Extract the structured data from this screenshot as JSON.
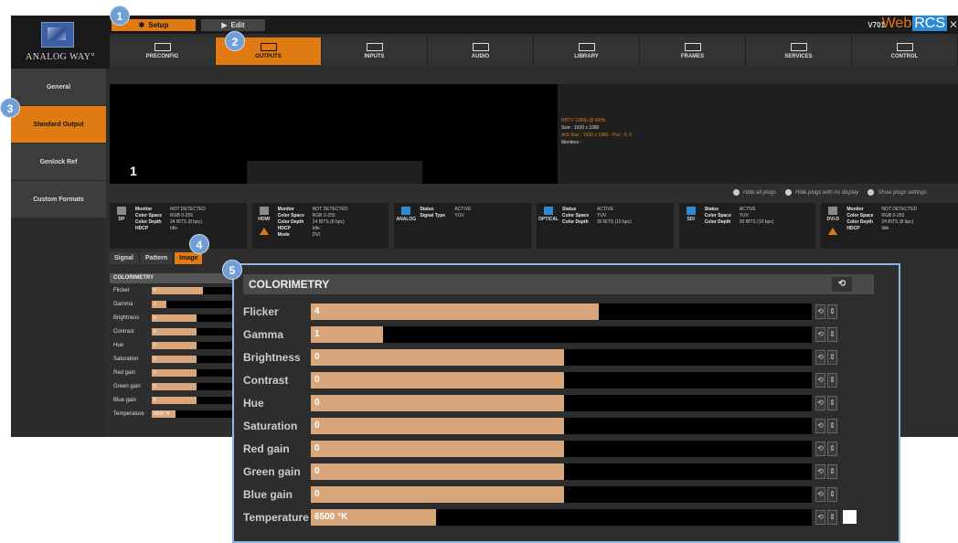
{
  "topbar": {
    "logo_text": "ANALOG WAY°",
    "mode_setup": "Setup",
    "mode_edit": "Edit",
    "version": "V701",
    "brand_web": "Web",
    "brand_rcs": "RCS",
    "close": "✕"
  },
  "nav": {
    "tabs": [
      {
        "label": "PRECONFIG"
      },
      {
        "label": "OUTPUTS"
      },
      {
        "label": "INPUTS"
      },
      {
        "label": "AUDIO"
      },
      {
        "label": "LIBRARY"
      },
      {
        "label": "FRAMES"
      },
      {
        "label": "SERVICES"
      },
      {
        "label": "CONTROL"
      }
    ]
  },
  "sidebar": {
    "items": [
      {
        "label": "General"
      },
      {
        "label": "Standard Output"
      },
      {
        "label": "Genlock Ref"
      },
      {
        "label": "Custom Formats"
      }
    ]
  },
  "preview": {
    "screen_number": "1",
    "info_line1": "HDTV 1080p @ 60Hz",
    "info_line2": "Size : 1920 x 1080",
    "info_line3": "AOI Size : 1920 x 1080 - Pos : 0, 0",
    "info_line4": "Monitors :"
  },
  "plug_controls": {
    "hide_all": "Hide all plugs",
    "hide_no_display": "Hide plugs with no display",
    "show_settings": "Show plugs settings"
  },
  "plugs": [
    {
      "name": "DP",
      "lines": [
        [
          "Monitor",
          "NOT DETECTED"
        ],
        [
          "Color Space",
          "RGB 0-255"
        ],
        [
          "Color Depth",
          "24 BITS (8 bpc)"
        ],
        [
          "HDCP",
          "Idle"
        ]
      ],
      "warn": false
    },
    {
      "name": "HDMI",
      "lines": [
        [
          "Monitor",
          "NOT DETECTED"
        ],
        [
          "Color Space",
          "RGB 0-255"
        ],
        [
          "Color Depth",
          "24 BITS (8 bpc)"
        ],
        [
          "HDCP",
          "Idle"
        ],
        [
          "Mode",
          "DVI"
        ]
      ],
      "warn": true
    },
    {
      "name": "ANALOG",
      "lines": [
        [
          "Status",
          "ACTIVE"
        ],
        [
          "Signal Type",
          "YUV"
        ]
      ],
      "warn": false
    },
    {
      "name": "OPTICAL",
      "lines": [
        [
          "Status",
          "ACTIVE"
        ],
        [
          "Color Space",
          "YUV"
        ],
        [
          "Color Depth",
          "30 BITS (10 bpc)"
        ]
      ],
      "warn": false
    },
    {
      "name": "SDI",
      "lines": [
        [
          "Status",
          "ACTIVE"
        ],
        [
          "Color Space",
          "YUV"
        ],
        [
          "Color Depth",
          "30 BITS (10 bpc)"
        ]
      ],
      "warn": false
    },
    {
      "name": "DVI-D",
      "lines": [
        [
          "Monitor",
          "NOT DETECTED"
        ],
        [
          "Color Space",
          "RGB 0-255"
        ],
        [
          "Color Depth",
          "24 BITS (8 bpc)"
        ],
        [
          "HDCP",
          "Idle"
        ]
      ],
      "warn": true
    }
  ],
  "subtabs": [
    {
      "label": "Signal"
    },
    {
      "label": "Pattern"
    },
    {
      "label": "Image"
    }
  ],
  "colorimetry": {
    "title": "COLORIMETRY",
    "reset": "⟲",
    "rows": [
      {
        "label": "Flicker",
        "value": "4",
        "fraction": 0.575
      },
      {
        "label": "Gamma",
        "value": "1",
        "fraction": 0.145
      },
      {
        "label": "Brightness",
        "value": "0",
        "fraction": 0.505
      },
      {
        "label": "Contrast",
        "value": "0",
        "fraction": 0.505
      },
      {
        "label": "Hue",
        "value": "0",
        "fraction": 0.505
      },
      {
        "label": "Saturation",
        "value": "0",
        "fraction": 0.505
      },
      {
        "label": "Red gain",
        "value": "0",
        "fraction": 0.505
      },
      {
        "label": "Green gain",
        "value": "0",
        "fraction": 0.505
      },
      {
        "label": "Blue gain",
        "value": "0",
        "fraction": 0.505
      },
      {
        "label": "Temperature",
        "value": "6500 °K",
        "fraction": 0.25
      }
    ]
  },
  "callouts": [
    "1",
    "2",
    "3",
    "4",
    "5"
  ],
  "colors": {
    "accent": "#e07b13",
    "slider_fill": "#d9a57a",
    "callout": "#6f9fd6"
  }
}
